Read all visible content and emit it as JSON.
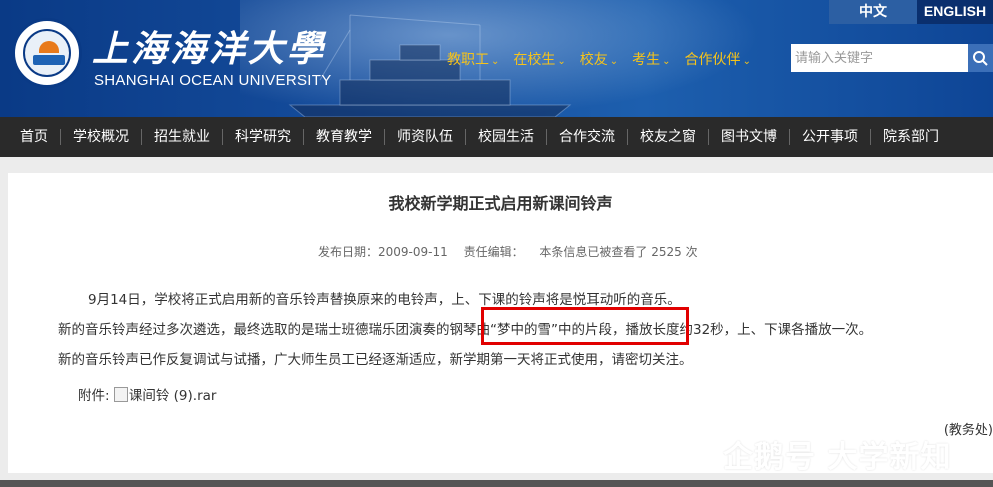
{
  "header": {
    "school_name_cn": "上海海洋大學",
    "school_name_en": "SHANGHAI OCEAN UNIVERSITY",
    "lang_cn": "中文",
    "lang_en": "ENGLISH",
    "top_nav": [
      "教职工",
      "在校生",
      "校友",
      "考生",
      "合作伙伴"
    ],
    "search_placeholder": "请输入关键字"
  },
  "main_nav": [
    "首页",
    "学校概况",
    "招生就业",
    "科学研究",
    "教育教学",
    "师资队伍",
    "校园生活",
    "合作交流",
    "校友之窗",
    "图书文博",
    "公开事项",
    "院系部门"
  ],
  "article": {
    "title": "我校新学期正式启用新课间铃声",
    "publish_date": "发布日期：2009-09-11",
    "editor": "责任编辑：",
    "views": "本条信息已被查看了  2525  次",
    "para1": "9月14日，学校将正式启用新的音乐铃声替换原来的电铃声，上、下课的铃声将是悦耳动听的音乐。",
    "para2": "新的音乐铃声经过多次遴选，最终选取的是瑞士班德瑞乐团演奏的钢琴曲“梦中的雪”中的片段，播放长度约32秒，上、下课各播放一次。",
    "para3": "新的音乐铃声已作反复调试与试播，广大师生员工已经逐渐适应，新学期第一天将正式使用，请密切关注。",
    "attachment_label": "附件:",
    "attachment_file": "课间铃 (9).rar",
    "signature": "(教务处)"
  },
  "watermark": "企鹅号 大学新知",
  "colors": {
    "header_blue": "#1a4f9c",
    "nav_gold": "#f6c31a",
    "main_nav_bg": "#2a2a2a",
    "highlight_red": "#e10000"
  }
}
